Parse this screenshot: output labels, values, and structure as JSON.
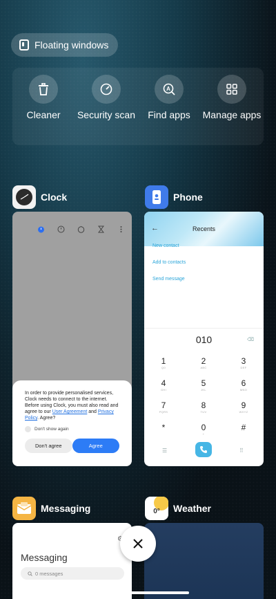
{
  "floating_windows": {
    "label": "Floating windows"
  },
  "quick_actions": [
    {
      "label": "Cleaner",
      "icon": "trash-icon"
    },
    {
      "label": "Security scan",
      "icon": "security-gauge-icon"
    },
    {
      "label": "Find apps",
      "icon": "find-apps-icon"
    },
    {
      "label": "Manage apps",
      "icon": "grid-icon"
    }
  ],
  "cards": {
    "clock": {
      "name": "Clock",
      "dialog": {
        "text_1": "In order to provide personalised services, Clock needs to connect to the internet. Before using Clock, you must also read and agree to our ",
        "link_agreement": "User Agreement",
        "text_2": " and ",
        "link_privacy": "Privacy Policy",
        "text_3": ". Agree?",
        "checkbox_label": "Don't show again",
        "decline_label": "Don't agree",
        "accept_label": "Agree"
      }
    },
    "phone": {
      "name": "Phone",
      "title": "Recents",
      "links": [
        "New contact",
        "Add to contacts",
        "Send message"
      ],
      "dialed_number": "010",
      "keys": [
        {
          "digit": "1",
          "letters": "Q0"
        },
        {
          "digit": "2",
          "letters": "ABC"
        },
        {
          "digit": "3",
          "letters": "DEF"
        },
        {
          "digit": "4",
          "letters": "GHI"
        },
        {
          "digit": "5",
          "letters": "JKL"
        },
        {
          "digit": "6",
          "letters": "MNO"
        },
        {
          "digit": "7",
          "letters": "PQRS"
        },
        {
          "digit": "8",
          "letters": "TUV"
        },
        {
          "digit": "9",
          "letters": "WXYZ"
        },
        {
          "digit": "*",
          "letters": ""
        },
        {
          "digit": "0",
          "letters": "+"
        },
        {
          "digit": "#",
          "letters": ""
        }
      ]
    },
    "messaging": {
      "name": "Messaging",
      "title": "Messaging",
      "search_placeholder": "0 messages"
    },
    "weather": {
      "name": "Weather",
      "icon_temp": "0°"
    }
  },
  "colors": {
    "accent_blue": "#2d7cf6",
    "phone_teal": "#46b6e5",
    "messaging_yellow": "#f5b544",
    "weather_yellow": "#f7c948"
  }
}
